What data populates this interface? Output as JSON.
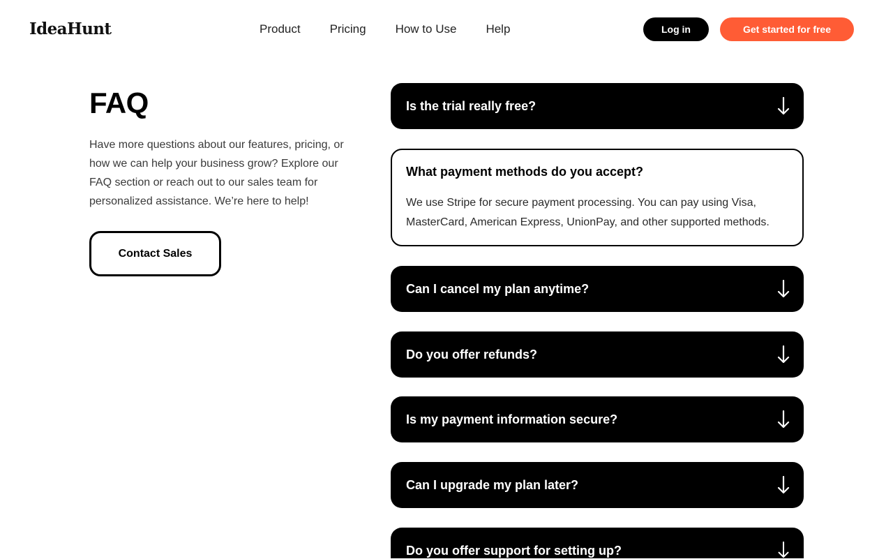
{
  "brand": {
    "name": "IdeaHunt"
  },
  "nav": {
    "items": [
      {
        "label": "Product"
      },
      {
        "label": "Pricing"
      },
      {
        "label": "How to Use"
      },
      {
        "label": "Help"
      }
    ]
  },
  "header": {
    "login_label": "Log in",
    "cta_label": "Get started for free"
  },
  "faq_intro": {
    "title": "FAQ",
    "description": "Have more questions about our features, pricing, or how we can help your business grow? Explore our FAQ section or reach out to our sales team for personalized assistance. We’re here to help!",
    "contact_label": "Contact Sales"
  },
  "faqs": [
    {
      "question": "Is the trial really free?",
      "expanded": false
    },
    {
      "question": "What payment methods do you accept?",
      "expanded": true,
      "answer": "We use Stripe for secure payment processing. You can pay using Visa, MasterCard, American Express, UnionPay, and other supported methods."
    },
    {
      "question": "Can I cancel my plan anytime?",
      "expanded": false
    },
    {
      "question": "Do you offer refunds?",
      "expanded": false
    },
    {
      "question": "Is my payment information secure?",
      "expanded": false
    },
    {
      "question": "Can I upgrade my plan later?",
      "expanded": false
    },
    {
      "question": "Do you offer support for setting up?",
      "expanded": false
    }
  ],
  "icons": {
    "collapsed_indicator": "arrow-down-icon"
  },
  "colors": {
    "accent": "#ff5c35",
    "primary": "#000000",
    "background": "#ffffff"
  }
}
